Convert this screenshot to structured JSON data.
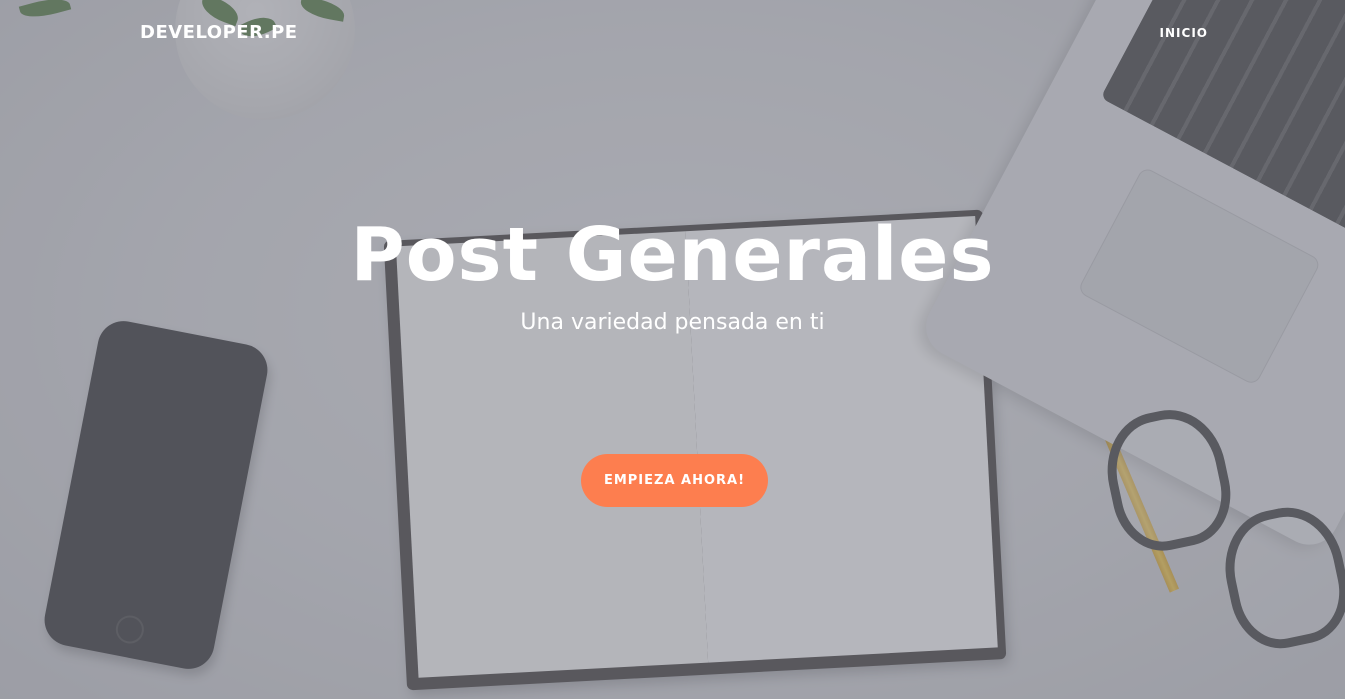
{
  "navbar": {
    "brand": "DEVELOPER.PE",
    "links": [
      {
        "label": "INICIO"
      }
    ]
  },
  "hero": {
    "title": "Post Generales",
    "subtitle": "Una variedad pensada en ti",
    "cta_label": "EMPIEZA AHORA!"
  },
  "colors": {
    "accent": "#fd7e4f",
    "text": "#ffffff"
  }
}
